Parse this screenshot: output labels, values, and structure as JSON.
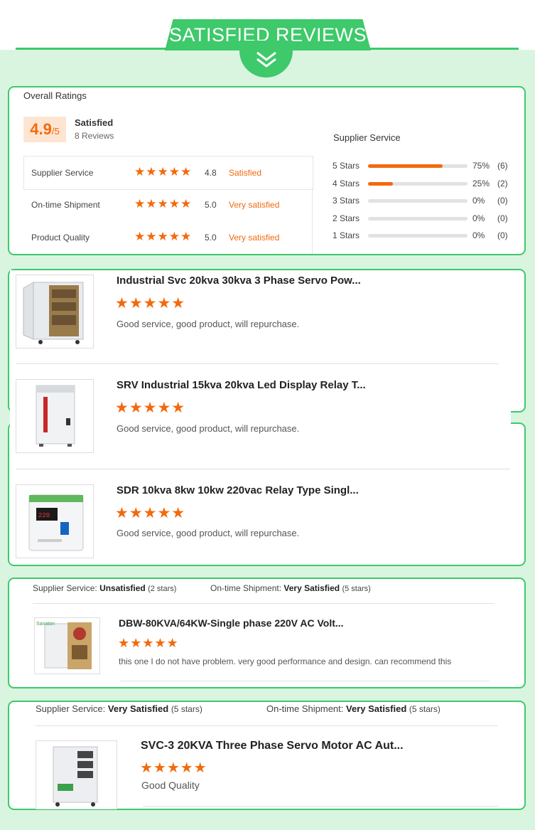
{
  "header": {
    "title": "SATISFIED REVIEWS"
  },
  "ratings": {
    "heading": "Overall Ratings",
    "score": "4.9",
    "score_suffix": "/5",
    "score_label": "Satisfied",
    "review_count": "8 Reviews",
    "rows": [
      {
        "label": "Supplier Service",
        "value": "4.8",
        "status": "Satisfied"
      },
      {
        "label": "On-time Shipment",
        "value": "5.0",
        "status": "Very satisfied"
      },
      {
        "label": "Product Quality",
        "value": "5.0",
        "status": "Very satisfied"
      }
    ],
    "supplier_heading": "Supplier Service",
    "distribution": [
      {
        "label": "5 Stars",
        "percent_text": "75%",
        "count": "(6)",
        "fraction": 0.75
      },
      {
        "label": "4 Stars",
        "percent_text": "25%",
        "count": "(2)",
        "fraction": 0.25
      },
      {
        "label": "3 Stars",
        "percent_text": "0%",
        "count": "(0)",
        "fraction": 0
      },
      {
        "label": "2 Stars",
        "percent_text": "0%",
        "count": "(0)",
        "fraction": 0
      },
      {
        "label": "1 Stars",
        "percent_text": "0%",
        "count": "(0)",
        "fraction": 0
      }
    ]
  },
  "stars_glyph": "★★★★★",
  "reviews_a": [
    {
      "title": "Industrial Svc 20kva 30kva 3 Phase Servo Pow...",
      "text": "Good service, good product, will repurchase.",
      "icon": "servo-cabinet-image"
    },
    {
      "title": "SRV Industrial 15kva 20kva Led Display Relay T...",
      "text": "Good service, good product, will repurchase.",
      "icon": "stabilizer-cabinet-image"
    },
    {
      "title": "SDR 10kva 8kw 10kw 220vac Relay Type Singl...",
      "text": "Good service, good product, will repurchase.",
      "icon": "wall-stabilizer-image"
    }
  ],
  "review_b": {
    "supplier_label": "Supplier Service:",
    "supplier_value": "Unsatisfied",
    "supplier_stars": "(2 stars)",
    "shipment_label": "On-time Shipment:",
    "shipment_value": "Very Satisfied",
    "shipment_stars": "(5 stars)",
    "title": "DBW-80KVA/64KW-Single phase 220V AC Volt...",
    "text": "this one I do not have problem. very good performance and design. can recommend this"
  },
  "review_c": {
    "supplier_label": "Supplier Service:",
    "supplier_value": "Very Satisfied",
    "supplier_stars": "(5 stars)",
    "shipment_label": "On-time Shipment:",
    "shipment_value": "Very Satisfied",
    "shipment_stars": "(5 stars)",
    "title": "SVC-3 20KVA Three Phase Servo Motor AC Aut...",
    "text": "Good Quality"
  }
}
